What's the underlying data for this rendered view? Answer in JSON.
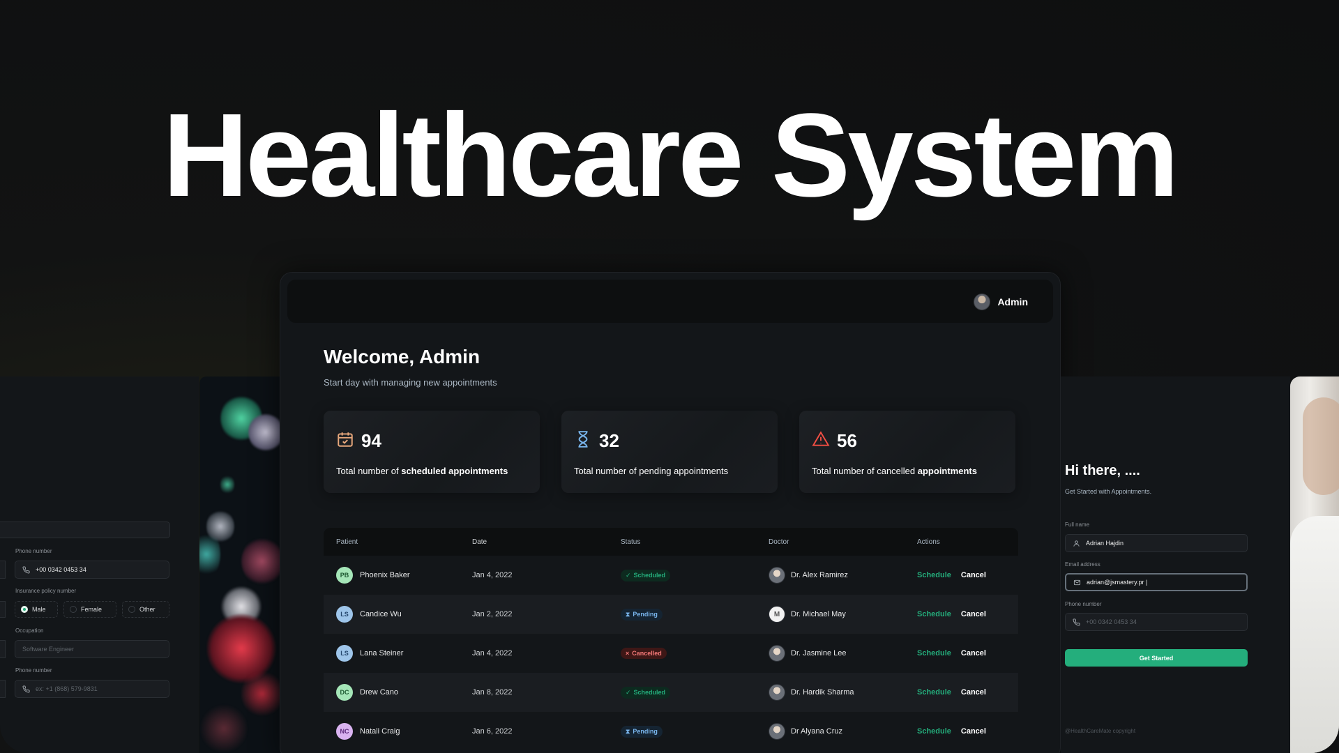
{
  "hero": {
    "title": "Healthcare System"
  },
  "left_form": {
    "phone_label": "Phone number",
    "phone_value": "+00 0342 0453 34",
    "insurance_label": "Insurance policy number",
    "gender_options": [
      "Male",
      "Female",
      "Other"
    ],
    "gender_selected": "Male",
    "occupation_label": "Occupation",
    "occupation_placeholder": "Software Engineer",
    "phone2_label": "Phone number",
    "phone2_placeholder": "ex: +1 (868) 579-9831"
  },
  "dashboard": {
    "user": "Admin",
    "welcome": "Welcome, Admin",
    "subtitle": "Start day with managing new appointments",
    "stats": [
      {
        "icon": "calendar-icon",
        "value": "94",
        "desc_pre": "Total number of ",
        "desc_strong": "scheduled appointments",
        "color": "#e8a87c"
      },
      {
        "icon": "hourglass-icon",
        "value": "32",
        "desc_pre": "Total number of pending appointments",
        "desc_strong": "",
        "color": "#79b5ec"
      },
      {
        "icon": "alert-icon",
        "value": "56",
        "desc_pre": "Total number of cancelled ",
        "desc_strong": "appointments",
        "color": "#f24e43"
      }
    ],
    "table": {
      "headers": [
        "Patient",
        "Date",
        "Status",
        "Doctor",
        "Actions"
      ],
      "rows": [
        {
          "initials": "PB",
          "patient": "Phoenix Baker",
          "date": "Jan 4, 2022",
          "status": "Scheduled",
          "doctor": "Dr. Alex Ramirez",
          "ini_bg": "#a5e6b8",
          "ini_fg": "#1e5a32"
        },
        {
          "initials": "LS",
          "patient": "Candice Wu",
          "date": "Jan 2, 2022",
          "status": "Pending",
          "doctor": "Dr. Michael May",
          "ini_bg": "#9ec5ea",
          "ini_fg": "#23456b"
        },
        {
          "initials": "LS",
          "patient": "Lana Steiner",
          "date": "Jan 4, 2022",
          "status": "Cancelled",
          "doctor": "Dr. Jasmine Lee",
          "ini_bg": "#9ec5ea",
          "ini_fg": "#23456b"
        },
        {
          "initials": "DC",
          "patient": "Drew Cano",
          "date": "Jan 8, 2022",
          "status": "Scheduled",
          "doctor": "Dr. Hardik Sharma",
          "ini_bg": "#a5e6b8",
          "ini_fg": "#1e5a32"
        },
        {
          "initials": "NC",
          "patient": "Natali Craig",
          "date": "Jan 6, 2022",
          "status": "Pending",
          "doctor": "Dr Alyana Cruz",
          "ini_bg": "#d9b3f0",
          "ini_fg": "#5b2a7a"
        }
      ],
      "action_schedule": "Schedule",
      "action_cancel": "Cancel"
    }
  },
  "right_form": {
    "greeting": "Hi there, ....",
    "subtitle": "Get Started with Appointments.",
    "fullname_label": "Full name",
    "fullname_value": "Adrian Hajdin",
    "email_label": "Email address",
    "email_value": "adrian@jsmastery.pr |",
    "phone_label": "Phone number",
    "phone_placeholder": "+00 0342 0453 34",
    "button": "Get Started",
    "copyright": "@HealthCareMate copyright"
  },
  "colors": {
    "accent": "#24ae7c",
    "pending": "#79b5ec",
    "cancelled": "#f37877"
  }
}
